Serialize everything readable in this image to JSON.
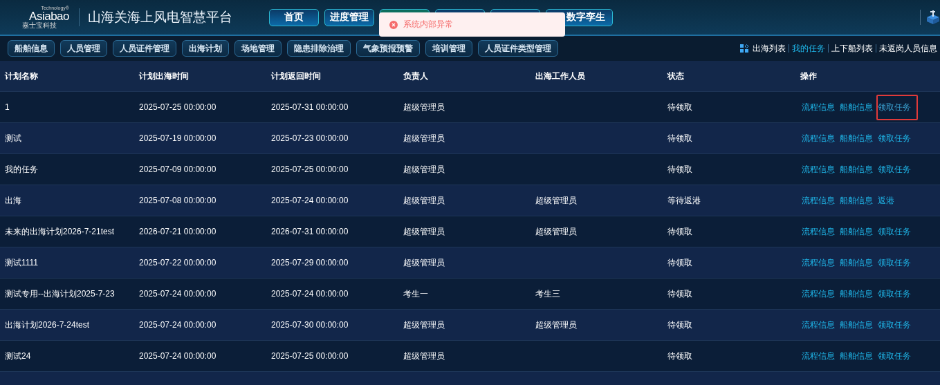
{
  "header": {
    "logo": {
      "tag": "Technology®",
      "wordmark": "Asiabao",
      "subtitle": "嘉士宝科技"
    },
    "title": "山海关海上风电智慧平台",
    "tabs": [
      {
        "label": "首页",
        "selected": false
      },
      {
        "label": "进度管理",
        "selected": false
      },
      {
        "selected": true
      },
      {
        "selected": false
      },
      {
        "selected": false
      },
      {
        "label": "数字孪生",
        "selected": false
      }
    ]
  },
  "toast": {
    "kind": "error",
    "message": "系统内部异常"
  },
  "subnav": {
    "items": [
      {
        "label": "船舶信息"
      },
      {
        "label": "人员管理"
      },
      {
        "label": "人员证件管理"
      },
      {
        "label": "出海计划"
      },
      {
        "label": "场地管理"
      },
      {
        "label": "隐患排除治理"
      },
      {
        "label": "气象预报预警"
      },
      {
        "label": "培训管理"
      },
      {
        "label": "人员证件类型管理"
      }
    ],
    "links": [
      {
        "label": "出海列表",
        "selected": false
      },
      {
        "label": "我的任务",
        "selected": true
      },
      {
        "label": "上下船列表",
        "selected": false
      },
      {
        "label": "未返岗人员信息",
        "selected": false
      }
    ]
  },
  "table": {
    "columns": [
      "计划名称",
      "计划出海时间",
      "计划返回时间",
      "负责人",
      "出海工作人员",
      "状态",
      "操作"
    ],
    "rows": [
      {
        "cells": [
          "1",
          "2025-07-25 00:00:00",
          "2025-07-31 00:00:00",
          "超级管理员",
          "",
          "待领取"
        ],
        "actions": [
          {
            "label": "流程信息",
            "highlighted": false
          },
          {
            "label": "船舶信息",
            "highlighted": false
          },
          {
            "label": "领取任务",
            "highlighted": true
          }
        ]
      },
      {
        "cells": [
          "测试",
          "2025-07-19 00:00:00",
          "2025-07-23 00:00:00",
          "超级管理员",
          "",
          "待领取"
        ],
        "actions": [
          {
            "label": "流程信息",
            "highlighted": false
          },
          {
            "label": "船舶信息",
            "highlighted": false
          },
          {
            "label": "领取任务",
            "highlighted": false
          }
        ]
      },
      {
        "cells": [
          "我的任务",
          "2025-07-09 00:00:00",
          "2025-07-25 00:00:00",
          "超级管理员",
          "",
          "待领取"
        ],
        "actions": [
          {
            "label": "流程信息",
            "highlighted": false
          },
          {
            "label": "船舶信息",
            "highlighted": false
          },
          {
            "label": "领取任务",
            "highlighted": false
          }
        ]
      },
      {
        "cells": [
          "出海",
          "2025-07-08 00:00:00",
          "2025-07-24 00:00:00",
          "超级管理员",
          "超级管理员",
          "等待返港"
        ],
        "actions": [
          {
            "label": "流程信息",
            "highlighted": false
          },
          {
            "label": "船舶信息",
            "highlighted": false
          },
          {
            "label": "返港",
            "highlighted": false
          }
        ]
      },
      {
        "cells": [
          "未来的出海计划2026-7-21test",
          "2026-07-21 00:00:00",
          "2026-07-31 00:00:00",
          "超级管理员",
          "超级管理员",
          "待领取"
        ],
        "actions": [
          {
            "label": "流程信息",
            "highlighted": false
          },
          {
            "label": "船舶信息",
            "highlighted": false
          },
          {
            "label": "领取任务",
            "highlighted": false
          }
        ]
      },
      {
        "cells": [
          "测试1111",
          "2025-07-22 00:00:00",
          "2025-07-29 00:00:00",
          "超级管理员",
          "",
          "待领取"
        ],
        "actions": [
          {
            "label": "流程信息",
            "highlighted": false
          },
          {
            "label": "船舶信息",
            "highlighted": false
          },
          {
            "label": "领取任务",
            "highlighted": false
          }
        ]
      },
      {
        "cells": [
          "测试专用--出海计划2025-7-23",
          "2025-07-24 00:00:00",
          "2025-07-24 00:00:00",
          "考生一",
          "考生三",
          "待领取"
        ],
        "actions": [
          {
            "label": "流程信息",
            "highlighted": false
          },
          {
            "label": "船舶信息",
            "highlighted": false
          },
          {
            "label": "领取任务",
            "highlighted": false
          }
        ]
      },
      {
        "cells": [
          "出海计划2026-7-24test",
          "2025-07-24 00:00:00",
          "2025-07-30 00:00:00",
          "超级管理员",
          "超级管理员",
          "待领取"
        ],
        "actions": [
          {
            "label": "流程信息",
            "highlighted": false
          },
          {
            "label": "船舶信息",
            "highlighted": false
          },
          {
            "label": "领取任务",
            "highlighted": false
          }
        ]
      },
      {
        "cells": [
          "测试24",
          "2025-07-24 00:00:00",
          "2025-07-25 00:00:00",
          "超级管理员",
          "",
          "待领取"
        ],
        "actions": [
          {
            "label": "流程信息",
            "highlighted": false
          },
          {
            "label": "船舶信息",
            "highlighted": false
          },
          {
            "label": "领取任务",
            "highlighted": false
          }
        ]
      }
    ]
  }
}
